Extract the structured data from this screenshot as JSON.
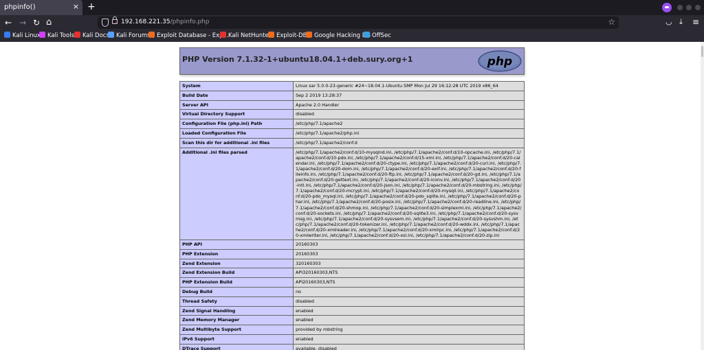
{
  "browser": {
    "tab_title": "phpinfo()",
    "close_icon": "×",
    "new_tab_icon": "+",
    "back_icon": "←",
    "forward_icon": "→",
    "reload_icon": "↻",
    "home_icon": "⌂",
    "url_host": "192.168.221.35",
    "url_path": "/phpinfo.php",
    "star_icon": "☆",
    "pocket_icon": "◡",
    "download_icon": "⤓",
    "menu_icon": "≡"
  },
  "bookmarks": [
    {
      "label": "Kali Linux",
      "icon": "kali-dragon-icon",
      "color": "#367bf0"
    },
    {
      "label": "Kali Tools",
      "icon": "kali-tools-icon",
      "color": "#d33eff"
    },
    {
      "label": "Kali Docs",
      "icon": "kali-docs-icon",
      "color": "#e4312b"
    },
    {
      "label": "Kali Forums",
      "icon": "kali-forums-icon",
      "color": "#5aa0ff"
    },
    {
      "label": "Exploit Database - Exp...",
      "icon": "exploit-db-icon",
      "color": "#ed6d1e"
    },
    {
      "label": "Kali NetHunter",
      "icon": "nethunter-icon",
      "color": "#e4312b"
    },
    {
      "label": "Exploit-DB",
      "icon": "exploit-db-icon",
      "color": "#ed6d1e"
    },
    {
      "label": "Google Hacking DB",
      "icon": "ghdb-icon",
      "color": "#ed6d1e"
    },
    {
      "label": "OffSec",
      "icon": "offsec-icon",
      "color": "#3b9ee0"
    }
  ],
  "phpinfo": {
    "title": "PHP Version 7.1.32-1+ubuntu18.04.1+deb.sury.org+1",
    "logo_text": "php",
    "rows": [
      {
        "key": "System",
        "value": "Linux sar 5.0.0-23-generic #24~18.04.1-Ubuntu SMP Mon Jul 29 16:12:28 UTC 2019 x86_64"
      },
      {
        "key": "Build Date",
        "value": "Sep 2 2019 13:28:37"
      },
      {
        "key": "Server API",
        "value": "Apache 2.0 Handler"
      },
      {
        "key": "Virtual Directory Support",
        "value": "disabled"
      },
      {
        "key": "Configuration File (php.ini) Path",
        "value": "/etc/php/7.1/apache2"
      },
      {
        "key": "Loaded Configuration File",
        "value": "/etc/php/7.1/apache2/php.ini"
      },
      {
        "key": "Scan this dir for additional .ini files",
        "value": "/etc/php/7.1/apache2/conf.d"
      },
      {
        "key": "Additional .ini files parsed",
        "value": "/etc/php/7.1/apache2/conf.d/10-mysqlnd.ini, /etc/php/7.1/apache2/conf.d/10-opcache.ini, /etc/php/7.1/apache2/conf.d/10-pdo.ini, /etc/php/7.1/apache2/conf.d/15-xml.ini, /etc/php/7.1/apache2/conf.d/20-calendar.ini, /etc/php/7.1/apache2/conf.d/20-ctype.ini, /etc/php/7.1/apache2/conf.d/20-curl.ini, /etc/php/7.1/apache2/conf.d/20-dom.ini, /etc/php/7.1/apache2/conf.d/20-exif.ini, /etc/php/7.1/apache2/conf.d/20-fileinfo.ini, /etc/php/7.1/apache2/conf.d/20-ftp.ini, /etc/php/7.1/apache2/conf.d/20-gd.ini, /etc/php/7.1/apache2/conf.d/20-gettext.ini, /etc/php/7.1/apache2/conf.d/20-iconv.ini, /etc/php/7.1/apache2/conf.d/20-intl.ini, /etc/php/7.1/apache2/conf.d/20-json.ini, /etc/php/7.1/apache2/conf.d/20-mbstring.ini, /etc/php/7.1/apache2/conf.d/20-mcrypt.ini, /etc/php/7.1/apache2/conf.d/20-mysqli.ini, /etc/php/7.1/apache2/conf.d/20-pdo_mysql.ini, /etc/php/7.1/apache2/conf.d/20-pdo_sqlite.ini, /etc/php/7.1/apache2/conf.d/20-phar.ini, /etc/php/7.1/apache2/conf.d/20-posix.ini, /etc/php/7.1/apache2/conf.d/20-readline.ini, /etc/php/7.1/apache2/conf.d/20-shmop.ini, /etc/php/7.1/apache2/conf.d/20-simplexml.ini, /etc/php/7.1/apache2/conf.d/20-sockets.ini, /etc/php/7.1/apache2/conf.d/20-sqlite3.ini, /etc/php/7.1/apache2/conf.d/20-sysvmsg.ini, /etc/php/7.1/apache2/conf.d/20-sysvsem.ini, /etc/php/7.1/apache2/conf.d/20-sysvshm.ini, /etc/php/7.1/apache2/conf.d/20-tokenizer.ini, /etc/php/7.1/apache2/conf.d/20-wddx.ini, /etc/php/7.1/apache2/conf.d/20-xmlreader.ini, /etc/php/7.1/apache2/conf.d/20-xmlrpc.ini, /etc/php/7.1/apache2/conf.d/20-xmlwriter.ini, /etc/php/7.1/apache2/conf.d/20-xsl.ini, /etc/php/7.1/apache2/conf.d/20-zip.ini"
      },
      {
        "key": "PHP API",
        "value": "20160303"
      },
      {
        "key": "PHP Extension",
        "value": "20160303"
      },
      {
        "key": "Zend Extension",
        "value": "320160303"
      },
      {
        "key": "Zend Extension Build",
        "value": "API320160303,NTS"
      },
      {
        "key": "PHP Extension Build",
        "value": "API20160303,NTS"
      },
      {
        "key": "Debug Build",
        "value": "no"
      },
      {
        "key": "Thread Safety",
        "value": "disabled"
      },
      {
        "key": "Zend Signal Handling",
        "value": "enabled"
      },
      {
        "key": "Zend Memory Manager",
        "value": "enabled"
      },
      {
        "key": "Zend Multibyte Support",
        "value": "provided by mbstring"
      },
      {
        "key": "IPv6 Support",
        "value": "enabled"
      },
      {
        "key": "DTrace Support",
        "value": "available, disabled"
      }
    ]
  },
  "colors": {
    "header_bg": "#9999cc",
    "key_cell_bg": "#ccccff",
    "value_cell_bg": "#dddddd",
    "border": "#666666"
  }
}
